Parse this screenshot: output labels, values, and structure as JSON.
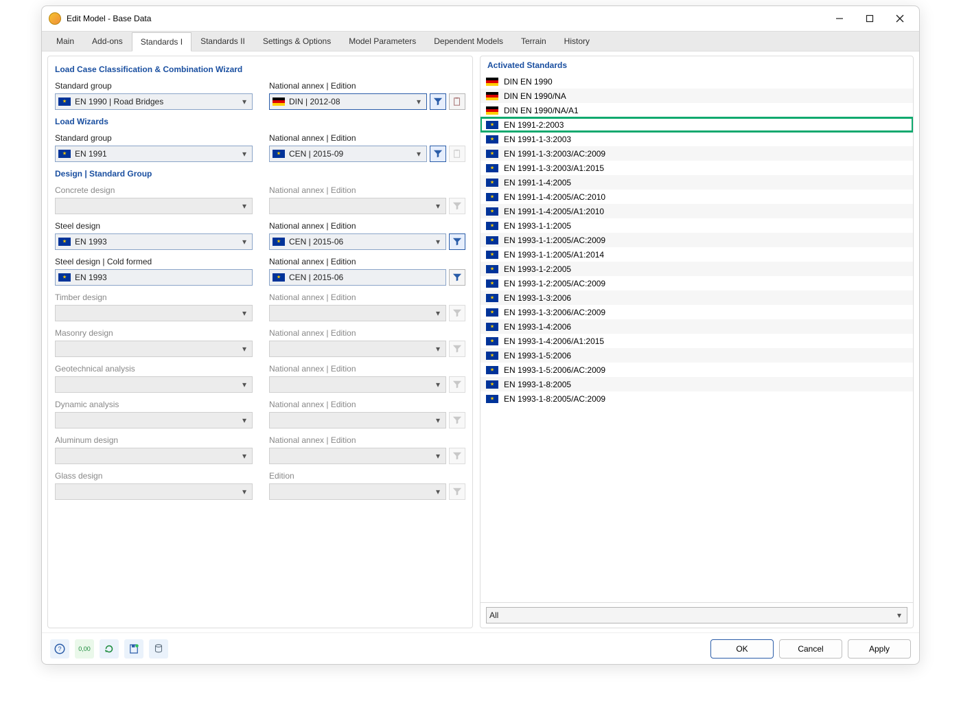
{
  "window": {
    "title": "Edit Model - Base Data"
  },
  "tabs": [
    "Main",
    "Add-ons",
    "Standards I",
    "Standards II",
    "Settings & Options",
    "Model Parameters",
    "Dependent Models",
    "Terrain",
    "History"
  ],
  "active_tab_index": 2,
  "sections": {
    "loadcase": {
      "title": "Load Case Classification & Combination Wizard",
      "group_label": "Standard group",
      "group_value": "EN 1990 | Road Bridges",
      "group_flag": "eu",
      "annex_label": "National annex | Edition",
      "annex_value": "DIN | 2012-08",
      "annex_flag": "de"
    },
    "loadwiz": {
      "title": "Load Wizards",
      "group_label": "Standard group",
      "group_value": "EN 1991",
      "group_flag": "eu",
      "annex_label": "National annex | Edition",
      "annex_value": "CEN | 2015-09",
      "annex_flag": "eu"
    },
    "design_title": "Design | Standard Group",
    "designs": [
      {
        "id": "concrete",
        "label": "Concrete design",
        "enabled": false,
        "group_value": "",
        "annex_label": "National annex | Edition",
        "annex_value": ""
      },
      {
        "id": "steel",
        "label": "Steel design",
        "enabled": true,
        "group_flag": "eu",
        "group_value": "EN 1993",
        "annex_label": "National annex | Edition",
        "annex_flag": "eu",
        "annex_value": "CEN | 2015-06",
        "filter_active": true
      },
      {
        "id": "coldform",
        "label": "Steel design | Cold formed",
        "enabled": true,
        "group_flag": "eu",
        "group_value": "EN 1993",
        "annex_label": "National annex | Edition",
        "annex_flag": "eu",
        "annex_value": "CEN | 2015-06",
        "no_caret": true
      },
      {
        "id": "timber",
        "label": "Timber design",
        "enabled": false,
        "group_value": "",
        "annex_label": "National annex | Edition",
        "annex_value": ""
      },
      {
        "id": "masonry",
        "label": "Masonry design",
        "enabled": false,
        "group_value": "",
        "annex_label": "National annex | Edition",
        "annex_value": ""
      },
      {
        "id": "geo",
        "label": "Geotechnical analysis",
        "enabled": false,
        "group_value": "",
        "annex_label": "National annex | Edition",
        "annex_value": ""
      },
      {
        "id": "dynamic",
        "label": "Dynamic analysis",
        "enabled": false,
        "group_value": "",
        "annex_label": "National annex | Edition",
        "annex_value": ""
      },
      {
        "id": "alu",
        "label": "Aluminum design",
        "enabled": false,
        "group_value": "",
        "annex_label": "National annex | Edition",
        "annex_value": ""
      },
      {
        "id": "glass",
        "label": "Glass design",
        "enabled": false,
        "group_value": "",
        "annex_label": "Edition",
        "annex_value": ""
      }
    ]
  },
  "activated": {
    "title": "Activated Standards",
    "filter_value": "All",
    "items": [
      {
        "flag": "de",
        "name": "DIN EN 1990"
      },
      {
        "flag": "de",
        "name": "DIN EN 1990/NA"
      },
      {
        "flag": "de",
        "name": "DIN EN 1990/NA/A1"
      },
      {
        "flag": "eu",
        "name": "EN 1991-2:2003",
        "highlight": true
      },
      {
        "flag": "eu",
        "name": "EN 1991-1-3:2003"
      },
      {
        "flag": "eu",
        "name": "EN 1991-1-3:2003/AC:2009"
      },
      {
        "flag": "eu",
        "name": "EN 1991-1-3:2003/A1:2015"
      },
      {
        "flag": "eu",
        "name": "EN 1991-1-4:2005"
      },
      {
        "flag": "eu",
        "name": "EN 1991-1-4:2005/AC:2010"
      },
      {
        "flag": "eu",
        "name": "EN 1991-1-4:2005/A1:2010"
      },
      {
        "flag": "eu",
        "name": "EN 1993-1-1:2005"
      },
      {
        "flag": "eu",
        "name": "EN 1993-1-1:2005/AC:2009"
      },
      {
        "flag": "eu",
        "name": "EN 1993-1-1:2005/A1:2014"
      },
      {
        "flag": "eu",
        "name": "EN 1993-1-2:2005"
      },
      {
        "flag": "eu",
        "name": "EN 1993-1-2:2005/AC:2009"
      },
      {
        "flag": "eu",
        "name": "EN 1993-1-3:2006"
      },
      {
        "flag": "eu",
        "name": "EN 1993-1-3:2006/AC:2009"
      },
      {
        "flag": "eu",
        "name": "EN 1993-1-4:2006"
      },
      {
        "flag": "eu",
        "name": "EN 1993-1-4:2006/A1:2015"
      },
      {
        "flag": "eu",
        "name": "EN 1993-1-5:2006"
      },
      {
        "flag": "eu",
        "name": "EN 1993-1-5:2006/AC:2009"
      },
      {
        "flag": "eu",
        "name": "EN 1993-1-8:2005"
      },
      {
        "flag": "eu",
        "name": "EN 1993-1-8:2005/AC:2009"
      }
    ]
  },
  "footer": {
    "ok": "OK",
    "cancel": "Cancel",
    "apply": "Apply"
  }
}
